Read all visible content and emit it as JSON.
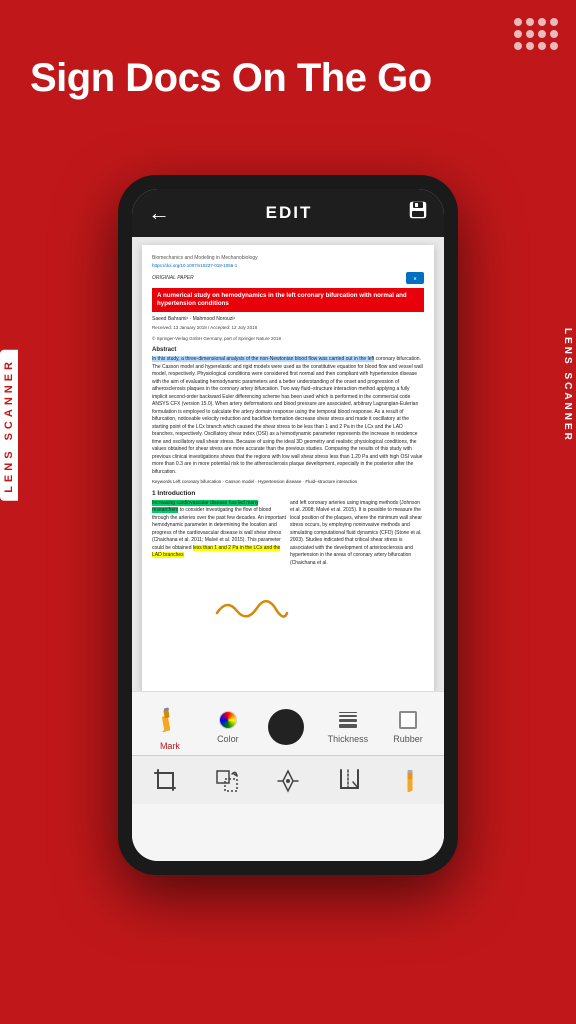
{
  "hero": {
    "title": "Sign Docs On The Go"
  },
  "topbar": {
    "title": "EDIT",
    "back_icon": "←",
    "save_icon": "💾"
  },
  "document": {
    "journal": "Biomechanics and Modeling in Mechanobiology",
    "doi": "https://doi.org/10.1007/s10237-018-1056-1",
    "original_paper_label": "ORIGINAL PAPER",
    "crossmark": "CrossMark",
    "red_title": "A numerical study on hemodynamics in the left coronary bifurcation\nwith normal and hypertension conditions",
    "authors": "Saeed Bahrami¹ · Mahmood Norouzi¹",
    "received": "Received: 13 January 2018 / Accepted: 12 July 2018",
    "publisher": "© Springer-Verlag GmbH Germany, part of Springer Nature 2018",
    "abstract_title": "Abstract",
    "abstract_highlight": "In this study, a three-dimensional analysis of the non-Newtonian blood flow was carried out in the left",
    "abstract_text": "coronary bifurcation. The Casson model and hyperelastic and rigid models were used as the constitutive equation for blood flow and vessel wall model, respectively. Physiological conditions were considered first normal and then compliant with hypertension disease with the aim of evaluating hemodynamic parameters and a better understanding of the onset and progression of atherosclerosis plaques in the coronary artery bifurcation. Two way fluid–structure interaction method applying a fully implicit second-order backward Euler differencing scheme has been used which is performed in the commercial code ANSYS CFX (version 15.0). When artery deformations and blood pressure are associated, arbitrary Lagrangian-Eulerian formulation is employed to calculate the artery domain response using the temporal blood response. As a result of bifurcation, noticeable velocity reduction and backflow formation decrease shear stress and made it oscillatory at the starting point of the LCx branch which caused the shear stress to be less than 1 and 2 Pa in the LCx and the LAD branches, respectively. Oscillatory shear index (OSI) as a hemodynamic parameter represents the increase in residence time and oscillatory wall shear stress. Because of using the ideal 3D geometry and realistic physiological conditions, the values obtained for shear stress are more accurate than the previous studies. Comparing the results of this study with previous clinical investigations shows that the regions with low wall shear stress less than 1.20 Pa and with high OSI value more than 0.3 are in more potential risk to the atherosclerosis plaque development, especially in the posterior after the bifurcation.",
    "keywords": "Keywords Left coronary bifurcation · Casson model · Hypertension disease · Fluid–structure interaction",
    "section1_title": "1 Introduction",
    "intro_left_highlight": "Increasing cardiovascular disease has led many researchers",
    "intro_left_text": "to consider investigating the flow of blood through the arteries over the past few decades. An important hemodynamic parameter in determining the location and progress of the cardiovascular disease is wall shear stress (Chaichana et al. 2011; Malvé et al. 2015). This parameter could be obtained",
    "intro_left_highlight2": "less than 1 and 2 Pa in the LCx and the LAD branches",
    "intro_right_text": "and left coronary arteries using imaging methods (Johnson et al. 2008; Malvé et al. 2015). It is possible to measure the local position of the plaques, where the minimum wall shear stress occurs, by employing noninvasive methods and simulating computational fluid dynamics (CFD) (Stone et al. 2003). Studies indicated that critical shear stress is associated with the development of arteriosclerosis and hypertension in the areas of coronary artery bifurcation (Chaichana et al."
  },
  "toolbar": {
    "mark_label": "Mark",
    "color_label": "Color",
    "thickness_label": "Thickness",
    "rubber_label": "Rubber"
  },
  "side_labels": {
    "left": "LENS SCANNER",
    "right": "LENS SCANNER"
  },
  "bottom_actions": {
    "crop_icon": "crop",
    "rotate_icon": "rotate",
    "pen_icon": "pen",
    "cut_icon": "cut",
    "pencil_icon": "pencil"
  }
}
